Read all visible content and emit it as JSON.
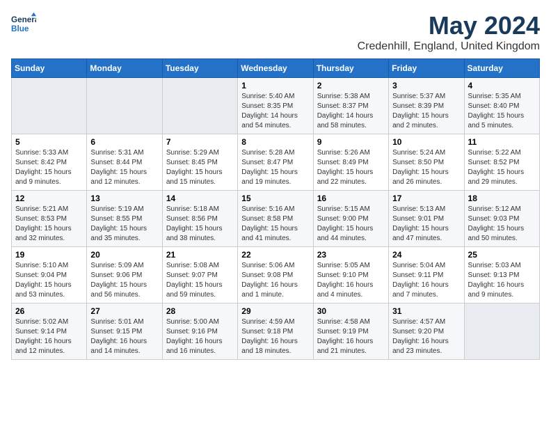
{
  "logo": {
    "text_general": "General",
    "text_blue": "Blue"
  },
  "title": "May 2024",
  "subtitle": "Credenhill, England, United Kingdom",
  "days_of_week": [
    "Sunday",
    "Monday",
    "Tuesday",
    "Wednesday",
    "Thursday",
    "Friday",
    "Saturday"
  ],
  "weeks": [
    [
      {
        "day": "",
        "sunrise": "",
        "sunset": "",
        "daylight": ""
      },
      {
        "day": "",
        "sunrise": "",
        "sunset": "",
        "daylight": ""
      },
      {
        "day": "",
        "sunrise": "",
        "sunset": "",
        "daylight": ""
      },
      {
        "day": "1",
        "sunrise": "Sunrise: 5:40 AM",
        "sunset": "Sunset: 8:35 PM",
        "daylight": "Daylight: 14 hours and 54 minutes."
      },
      {
        "day": "2",
        "sunrise": "Sunrise: 5:38 AM",
        "sunset": "Sunset: 8:37 PM",
        "daylight": "Daylight: 14 hours and 58 minutes."
      },
      {
        "day": "3",
        "sunrise": "Sunrise: 5:37 AM",
        "sunset": "Sunset: 8:39 PM",
        "daylight": "Daylight: 15 hours and 2 minutes."
      },
      {
        "day": "4",
        "sunrise": "Sunrise: 5:35 AM",
        "sunset": "Sunset: 8:40 PM",
        "daylight": "Daylight: 15 hours and 5 minutes."
      }
    ],
    [
      {
        "day": "5",
        "sunrise": "Sunrise: 5:33 AM",
        "sunset": "Sunset: 8:42 PM",
        "daylight": "Daylight: 15 hours and 9 minutes."
      },
      {
        "day": "6",
        "sunrise": "Sunrise: 5:31 AM",
        "sunset": "Sunset: 8:44 PM",
        "daylight": "Daylight: 15 hours and 12 minutes."
      },
      {
        "day": "7",
        "sunrise": "Sunrise: 5:29 AM",
        "sunset": "Sunset: 8:45 PM",
        "daylight": "Daylight: 15 hours and 15 minutes."
      },
      {
        "day": "8",
        "sunrise": "Sunrise: 5:28 AM",
        "sunset": "Sunset: 8:47 PM",
        "daylight": "Daylight: 15 hours and 19 minutes."
      },
      {
        "day": "9",
        "sunrise": "Sunrise: 5:26 AM",
        "sunset": "Sunset: 8:49 PM",
        "daylight": "Daylight: 15 hours and 22 minutes."
      },
      {
        "day": "10",
        "sunrise": "Sunrise: 5:24 AM",
        "sunset": "Sunset: 8:50 PM",
        "daylight": "Daylight: 15 hours and 26 minutes."
      },
      {
        "day": "11",
        "sunrise": "Sunrise: 5:22 AM",
        "sunset": "Sunset: 8:52 PM",
        "daylight": "Daylight: 15 hours and 29 minutes."
      }
    ],
    [
      {
        "day": "12",
        "sunrise": "Sunrise: 5:21 AM",
        "sunset": "Sunset: 8:53 PM",
        "daylight": "Daylight: 15 hours and 32 minutes."
      },
      {
        "day": "13",
        "sunrise": "Sunrise: 5:19 AM",
        "sunset": "Sunset: 8:55 PM",
        "daylight": "Daylight: 15 hours and 35 minutes."
      },
      {
        "day": "14",
        "sunrise": "Sunrise: 5:18 AM",
        "sunset": "Sunset: 8:56 PM",
        "daylight": "Daylight: 15 hours and 38 minutes."
      },
      {
        "day": "15",
        "sunrise": "Sunrise: 5:16 AM",
        "sunset": "Sunset: 8:58 PM",
        "daylight": "Daylight: 15 hours and 41 minutes."
      },
      {
        "day": "16",
        "sunrise": "Sunrise: 5:15 AM",
        "sunset": "Sunset: 9:00 PM",
        "daylight": "Daylight: 15 hours and 44 minutes."
      },
      {
        "day": "17",
        "sunrise": "Sunrise: 5:13 AM",
        "sunset": "Sunset: 9:01 PM",
        "daylight": "Daylight: 15 hours and 47 minutes."
      },
      {
        "day": "18",
        "sunrise": "Sunrise: 5:12 AM",
        "sunset": "Sunset: 9:03 PM",
        "daylight": "Daylight: 15 hours and 50 minutes."
      }
    ],
    [
      {
        "day": "19",
        "sunrise": "Sunrise: 5:10 AM",
        "sunset": "Sunset: 9:04 PM",
        "daylight": "Daylight: 15 hours and 53 minutes."
      },
      {
        "day": "20",
        "sunrise": "Sunrise: 5:09 AM",
        "sunset": "Sunset: 9:06 PM",
        "daylight": "Daylight: 15 hours and 56 minutes."
      },
      {
        "day": "21",
        "sunrise": "Sunrise: 5:08 AM",
        "sunset": "Sunset: 9:07 PM",
        "daylight": "Daylight: 15 hours and 59 minutes."
      },
      {
        "day": "22",
        "sunrise": "Sunrise: 5:06 AM",
        "sunset": "Sunset: 9:08 PM",
        "daylight": "Daylight: 16 hours and 1 minute."
      },
      {
        "day": "23",
        "sunrise": "Sunrise: 5:05 AM",
        "sunset": "Sunset: 9:10 PM",
        "daylight": "Daylight: 16 hours and 4 minutes."
      },
      {
        "day": "24",
        "sunrise": "Sunrise: 5:04 AM",
        "sunset": "Sunset: 9:11 PM",
        "daylight": "Daylight: 16 hours and 7 minutes."
      },
      {
        "day": "25",
        "sunrise": "Sunrise: 5:03 AM",
        "sunset": "Sunset: 9:13 PM",
        "daylight": "Daylight: 16 hours and 9 minutes."
      }
    ],
    [
      {
        "day": "26",
        "sunrise": "Sunrise: 5:02 AM",
        "sunset": "Sunset: 9:14 PM",
        "daylight": "Daylight: 16 hours and 12 minutes."
      },
      {
        "day": "27",
        "sunrise": "Sunrise: 5:01 AM",
        "sunset": "Sunset: 9:15 PM",
        "daylight": "Daylight: 16 hours and 14 minutes."
      },
      {
        "day": "28",
        "sunrise": "Sunrise: 5:00 AM",
        "sunset": "Sunset: 9:16 PM",
        "daylight": "Daylight: 16 hours and 16 minutes."
      },
      {
        "day": "29",
        "sunrise": "Sunrise: 4:59 AM",
        "sunset": "Sunset: 9:18 PM",
        "daylight": "Daylight: 16 hours and 18 minutes."
      },
      {
        "day": "30",
        "sunrise": "Sunrise: 4:58 AM",
        "sunset": "Sunset: 9:19 PM",
        "daylight": "Daylight: 16 hours and 21 minutes."
      },
      {
        "day": "31",
        "sunrise": "Sunrise: 4:57 AM",
        "sunset": "Sunset: 9:20 PM",
        "daylight": "Daylight: 16 hours and 23 minutes."
      },
      {
        "day": "",
        "sunrise": "",
        "sunset": "",
        "daylight": ""
      }
    ]
  ]
}
